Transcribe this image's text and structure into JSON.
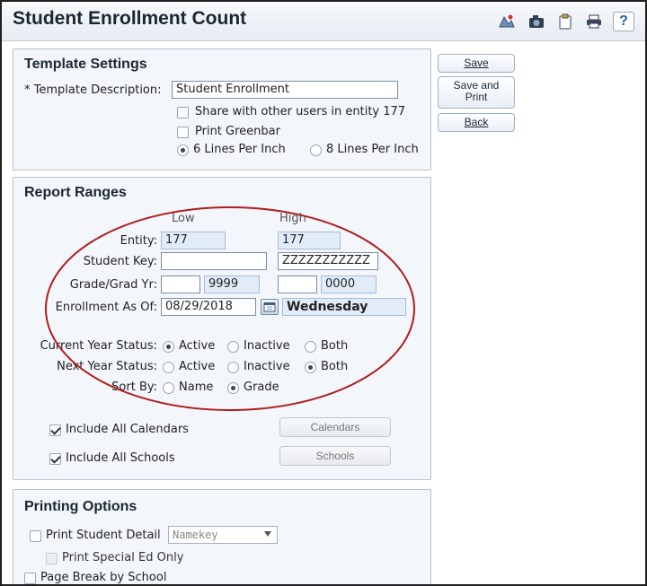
{
  "title": "Student Enrollment Count",
  "toolbar_icons": [
    "map-icon",
    "camera-icon",
    "clipboard-icon",
    "printer-icon",
    "help-icon"
  ],
  "help_glyph": "?",
  "actions": {
    "save": "Save",
    "save_print_line1": "Save and",
    "save_print_line2": "Print",
    "back": "Back"
  },
  "template": {
    "heading": "Template Settings",
    "desc_label": "* Template Description:",
    "desc_value": "Student Enrollment",
    "share_label": "Share with other users in entity 177",
    "greenbar_label": "Print Greenbar",
    "lines6_label": "6 Lines Per Inch",
    "lines8_label": "8 Lines Per Inch",
    "share_checked": false,
    "greenbar_checked": false,
    "lines_per_inch": 6
  },
  "ranges": {
    "heading": "Report Ranges",
    "low_header": "Low",
    "high_header": "High",
    "entity_label": "Entity:",
    "entity_low": "177",
    "entity_high": "177",
    "student_key_label": "Student Key:",
    "student_key_low": "",
    "student_key_high": "ZZZZZZZZZZZ",
    "grade_label": "Grade/Grad Yr:",
    "grade_low": "",
    "grad_yr_low": "9999",
    "grade_high": "",
    "grad_yr_high": "0000",
    "enroll_label": "Enrollment As Of:",
    "enroll_date": "08/29/2018",
    "enroll_day": "Wednesday",
    "cur_status_label": "Current Year Status:",
    "next_status_label": "Next Year Status:",
    "sort_label": "Sort By:",
    "opt_active": "Active",
    "opt_inactive": "Inactive",
    "opt_both": "Both",
    "opt_name": "Name",
    "opt_grade": "Grade",
    "cur_status": "Active",
    "next_status": "Both",
    "sort_by": "Grade",
    "calendars_label": "Include All Calendars",
    "calendars_button": "Calendars",
    "schools_label": "Include All Schools",
    "schools_button": "Schools",
    "calendars_checked": true,
    "schools_checked": true,
    "annotation_color": "#b01c1c"
  },
  "printing": {
    "heading": "Printing Options",
    "detail_label": "Print Student Detail",
    "detail_select": "Namekey",
    "special_ed_label": "Print Special Ed Only",
    "page_break_label": "Page Break by School"
  }
}
